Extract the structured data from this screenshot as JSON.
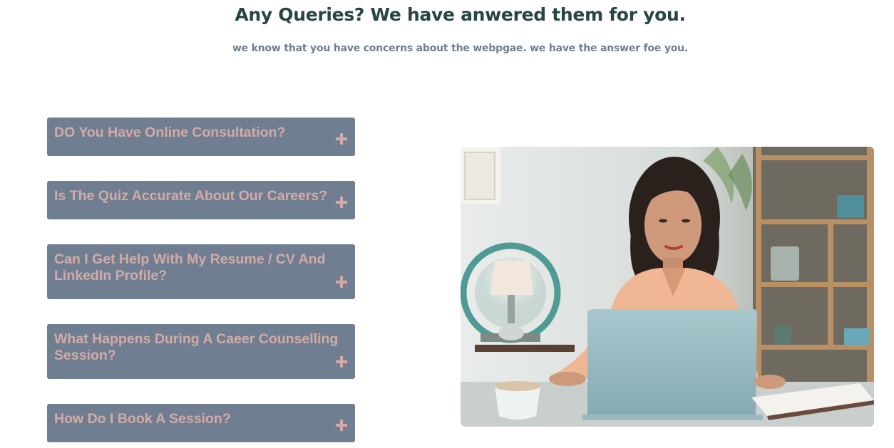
{
  "header": {
    "title": "Any Queries? We have anwered them for you.",
    "subtitle": "we know that you have concerns about the webpgae. we have the answer foe you."
  },
  "faq": {
    "items": [
      {
        "question": "DO You Have Online Consultation?",
        "icon": "plus-icon"
      },
      {
        "question": "Is The Quiz Accurate About Our Careers?",
        "icon": "plus-icon"
      },
      {
        "question": "Can I Get Help With My Resume / CV And LinkedIn Profile?",
        "icon": "plus-icon"
      },
      {
        "question": "What Happens During A Caeer Counselling Session?",
        "icon": "plus-icon"
      },
      {
        "question": "How Do I Book A Session?",
        "icon": "plus-icon"
      }
    ]
  },
  "colors": {
    "heading": "#274543",
    "subheading": "#6f7f8c",
    "faq_background": "#6f7f91",
    "faq_text": "#d4aaa6"
  }
}
